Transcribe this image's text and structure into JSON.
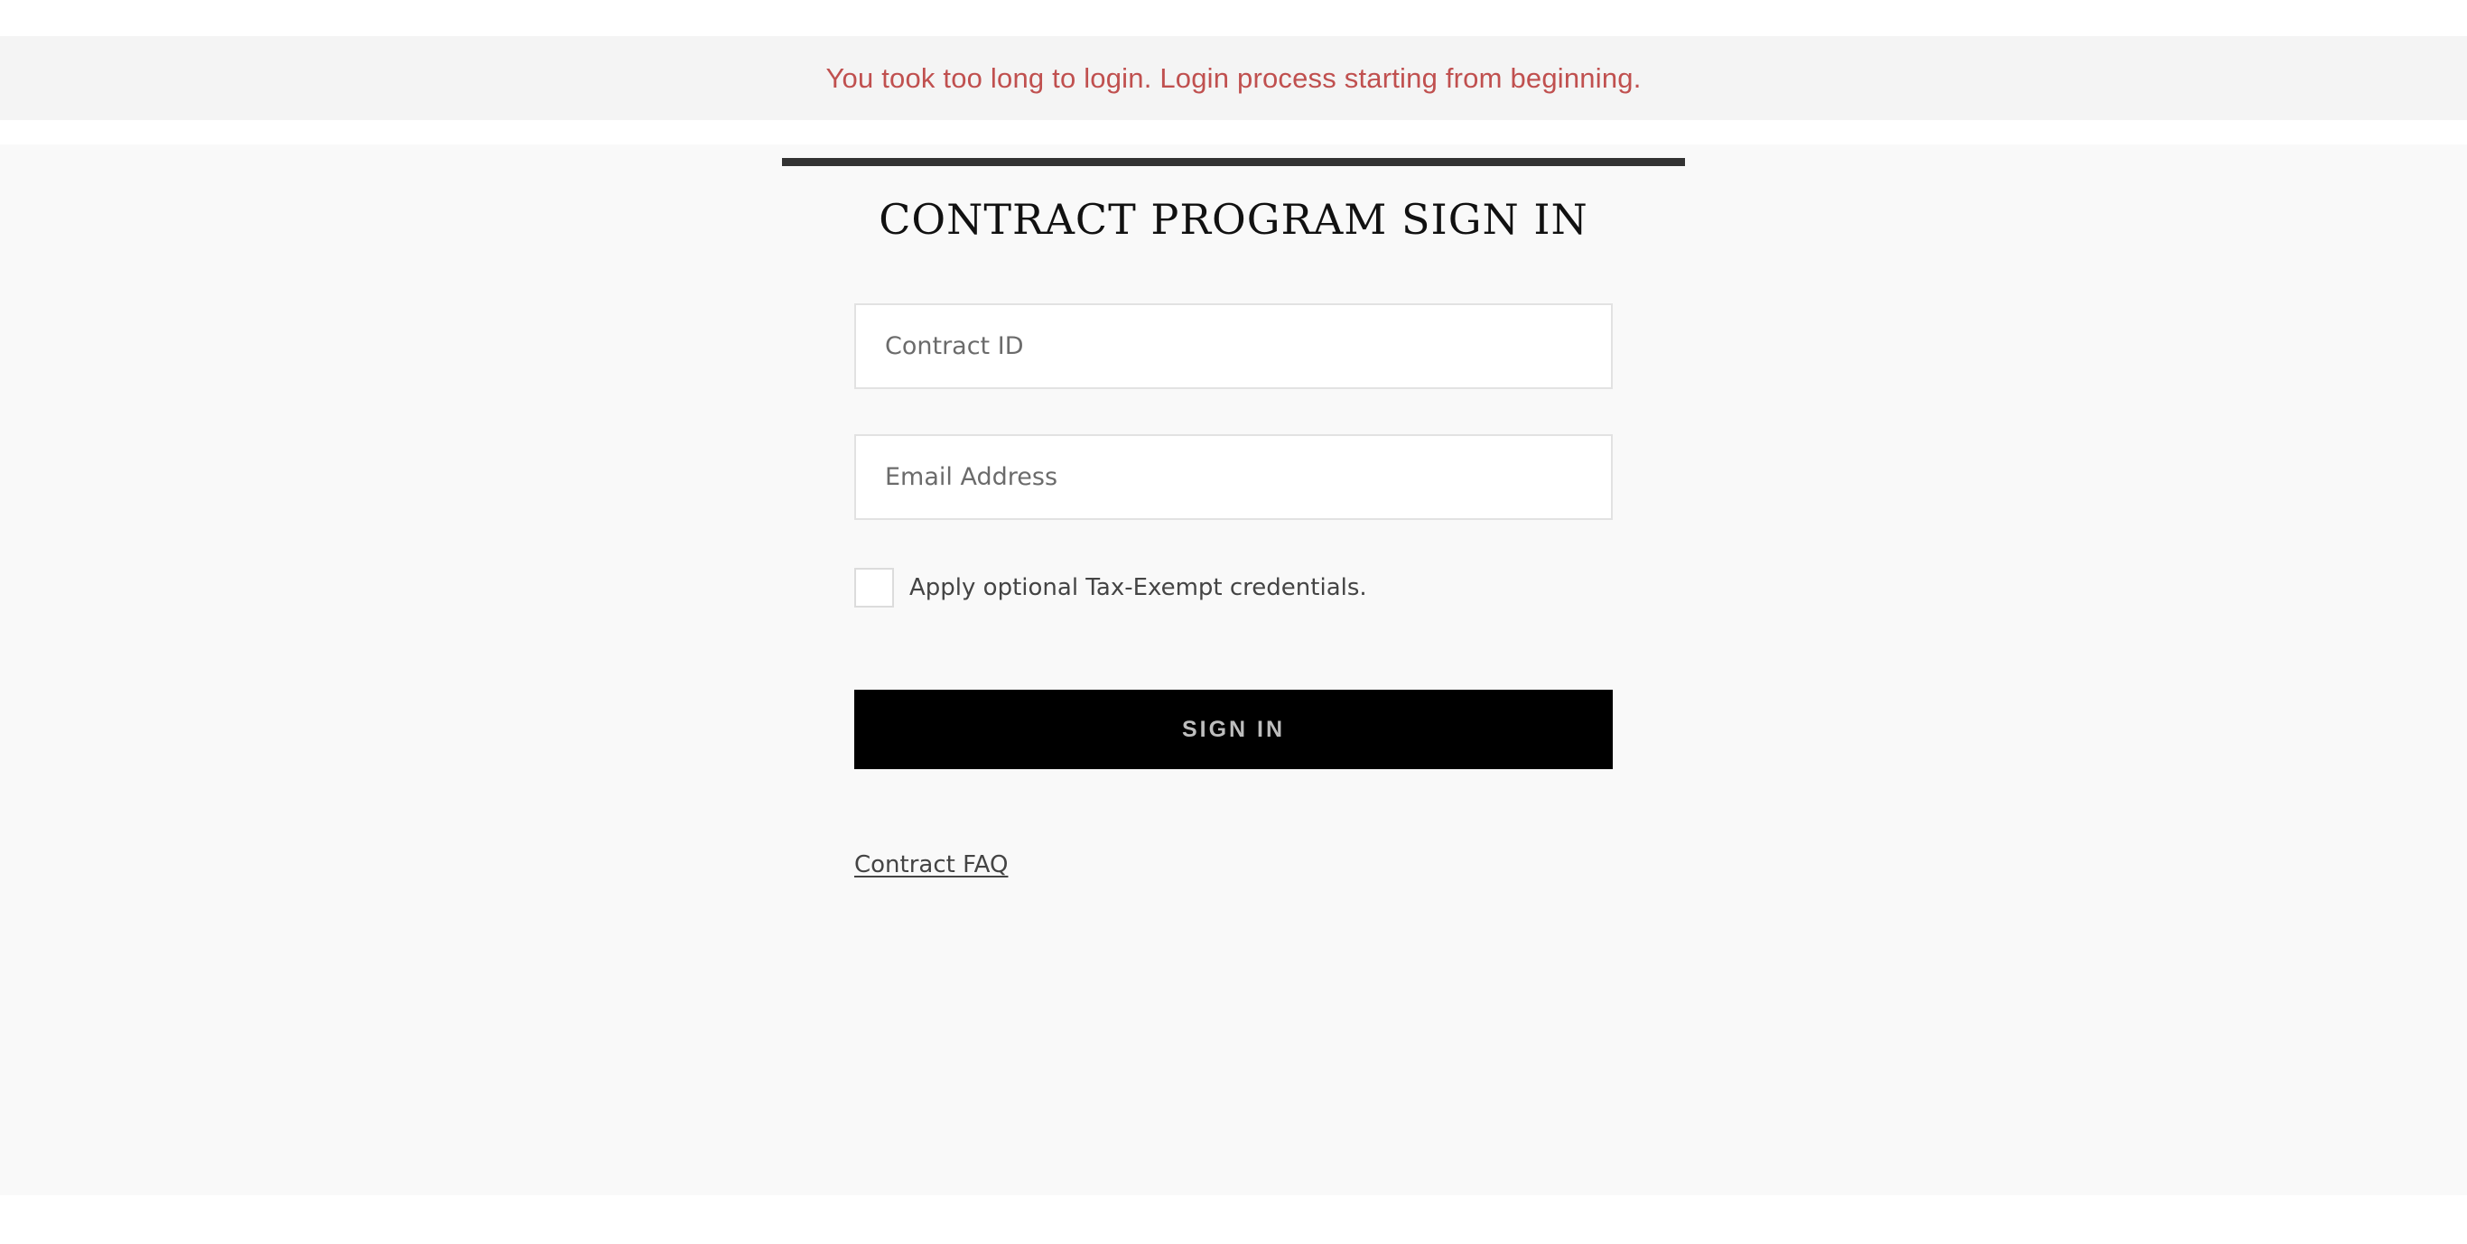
{
  "alert": {
    "message": "You took too long to login. Login process starting from beginning.",
    "color": "#c0504f"
  },
  "signin": {
    "title": "CONTRACT PROGRAM SIGN IN",
    "contract_id_placeholder": "Contract ID",
    "contract_id_value": "",
    "email_placeholder": "Email Address",
    "email_value": "",
    "tax_exempt_label": "Apply optional Tax-Exempt credentials.",
    "tax_exempt_checked": false,
    "button_label": "SIGN IN",
    "faq_link": "Contract FAQ"
  },
  "colors": {
    "button_background": "#000000",
    "panel_background": "#f9f9f9",
    "alert_background": "#f4f4f4"
  }
}
